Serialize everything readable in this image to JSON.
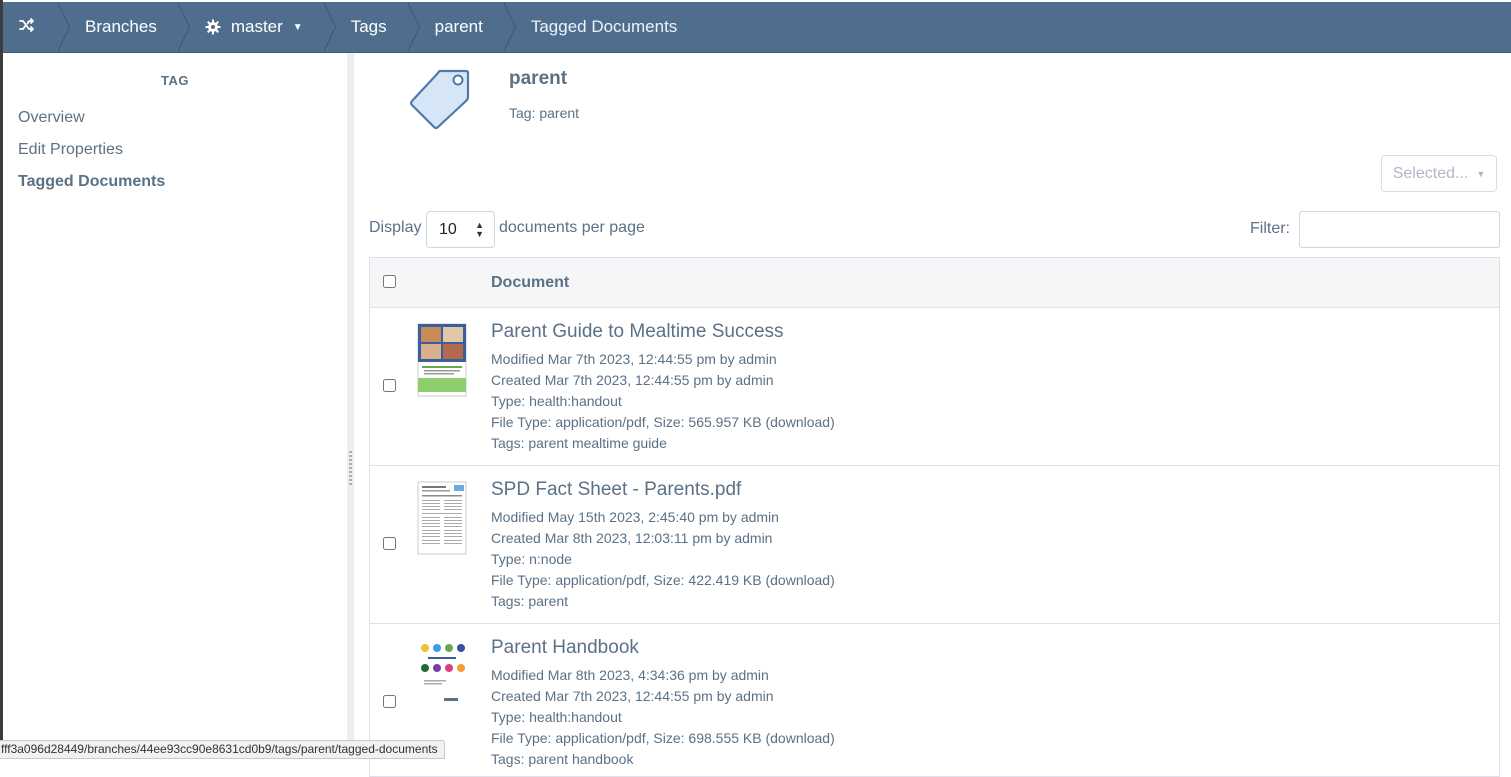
{
  "breadcrumb": {
    "home_icon": "shuffle-icon",
    "items": [
      "Branches",
      "master",
      "Tags",
      "parent",
      "Tagged Documents"
    ],
    "master_icon": "gear-icon"
  },
  "sidebar": {
    "heading": "TAG",
    "items": [
      {
        "label": "Overview",
        "active": false
      },
      {
        "label": "Edit Properties",
        "active": false
      },
      {
        "label": "Tagged Documents",
        "active": true
      }
    ]
  },
  "header": {
    "title": "parent",
    "subtitle": "Tag: parent",
    "icon": "tag-icon"
  },
  "toolbar": {
    "selected_label": "Selected...",
    "display_label": "Display",
    "per_page_value": "10",
    "per_page_suffix": "documents per page",
    "filter_label": "Filter:",
    "filter_value": ""
  },
  "table": {
    "column": "Document",
    "rows": [
      {
        "title": "Parent Guide to Mealtime Success",
        "modified": "Modified Mar 7th 2023, 12:44:55 pm by admin",
        "created": "Created Mar 7th 2023, 12:44:55 pm by admin",
        "type": "Type: health:handout",
        "file": "File Type: application/pdf, Size: 565.957 KB (download)",
        "tags": "Tags: parent mealtime guide"
      },
      {
        "title": "SPD Fact Sheet - Parents.pdf",
        "modified": "Modified May 15th 2023, 2:45:40 pm by admin",
        "created": "Created Mar 8th 2023, 12:03:11 pm by admin",
        "type": "Type: n:node",
        "file": "File Type: application/pdf, Size: 422.419 KB (download)",
        "tags": "Tags: parent"
      },
      {
        "title": "Parent Handbook",
        "modified": "Modified Mar 8th 2023, 4:34:36 pm by admin",
        "created": "Created Mar 7th 2023, 12:44:55 pm by admin",
        "type": "Type: health:handout",
        "file": "File Type: application/pdf, Size: 698.555 KB (download)",
        "tags": "Tags: parent handbook"
      }
    ]
  },
  "status_url": "fff3a096d28449/branches/44ee93cc90e8631cd0b9/tags/parent/tagged-documents",
  "colors": {
    "topbar": "#4f6e8e",
    "text": "#5b7186"
  }
}
